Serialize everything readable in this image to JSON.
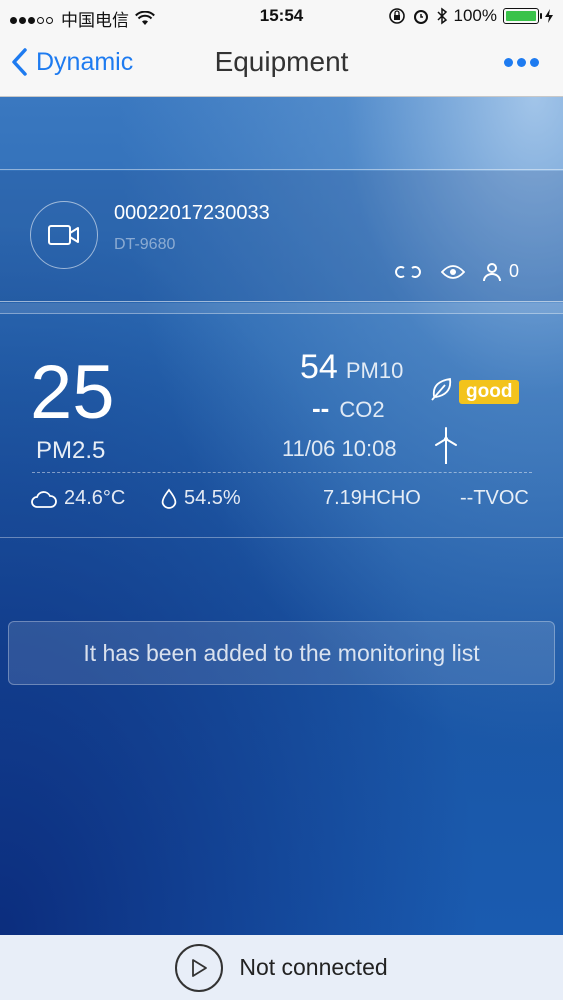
{
  "status_bar": {
    "carrier": "中国电信",
    "time": "15:54",
    "battery": "100%"
  },
  "nav": {
    "back_label": "Dynamic",
    "title": "Equipment"
  },
  "device": {
    "id": "00022017230033",
    "model": "DT-9680",
    "viewer_count": "0"
  },
  "air_quality": {
    "pm25_value": "25",
    "pm25_label": "PM2.5",
    "pm10_value": "54",
    "pm10_label": "PM10",
    "co2_value": "--",
    "co2_label": "CO2",
    "quality_badge": "good",
    "timestamp": "11/06 10:08",
    "temperature": "24.6°C",
    "humidity": "54.5%",
    "hcho": "7.19HCHO",
    "tvoc": "--TVOC"
  },
  "notice": "It has been added to the monitoring list",
  "footer": {
    "connection_status": "Not connected"
  },
  "colors": {
    "accent": "#1e7bf0",
    "badge": "#f3c31c"
  }
}
